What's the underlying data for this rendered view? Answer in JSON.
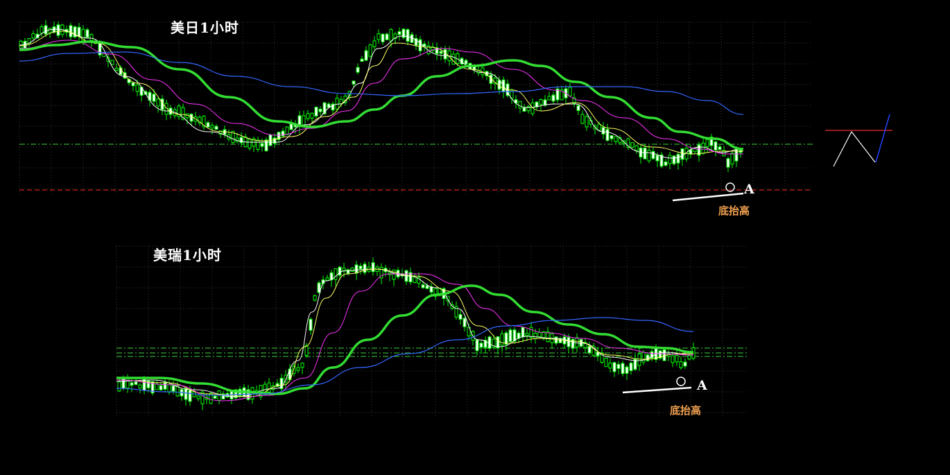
{
  "charts": [
    {
      "title": "美日1小时",
      "point_label": "A",
      "annotation": "底抬高"
    },
    {
      "title": "美瑞1小时",
      "point_label": "A",
      "annotation": "底抬高"
    }
  ],
  "chart_data": [
    {
      "type": "candlestick",
      "title": "美日1小时",
      "timeframe": "1H",
      "series": [
        {
          "name": "",
          "color": "#00ff00",
          "kind": "candles"
        },
        {
          "name": "",
          "color": "#ffffff",
          "kind": "moving-average"
        },
        {
          "name": "",
          "color": "#ffff66",
          "kind": "moving-average"
        },
        {
          "name": "",
          "color": "#ff33ff",
          "kind": "moving-average"
        },
        {
          "name": "",
          "color": "#33dd33",
          "kind": "moving-average"
        },
        {
          "name": "",
          "color": "#3366ff",
          "kind": "moving-average"
        }
      ],
      "annotations": [
        "A",
        "底抬高"
      ],
      "grid": true
    },
    {
      "type": "candlestick",
      "title": "美瑞1小时",
      "timeframe": "1H",
      "series": [
        {
          "name": "",
          "color": "#00ff00",
          "kind": "candles"
        },
        {
          "name": "",
          "color": "#ffffff",
          "kind": "moving-average"
        },
        {
          "name": "",
          "color": "#ffff66",
          "kind": "moving-average"
        },
        {
          "name": "",
          "color": "#ff33ff",
          "kind": "moving-average"
        },
        {
          "name": "",
          "color": "#33dd33",
          "kind": "moving-average"
        },
        {
          "name": "",
          "color": "#3366ff",
          "kind": "moving-average"
        }
      ],
      "annotations": [
        "A",
        "底抬高"
      ],
      "grid": true
    }
  ]
}
